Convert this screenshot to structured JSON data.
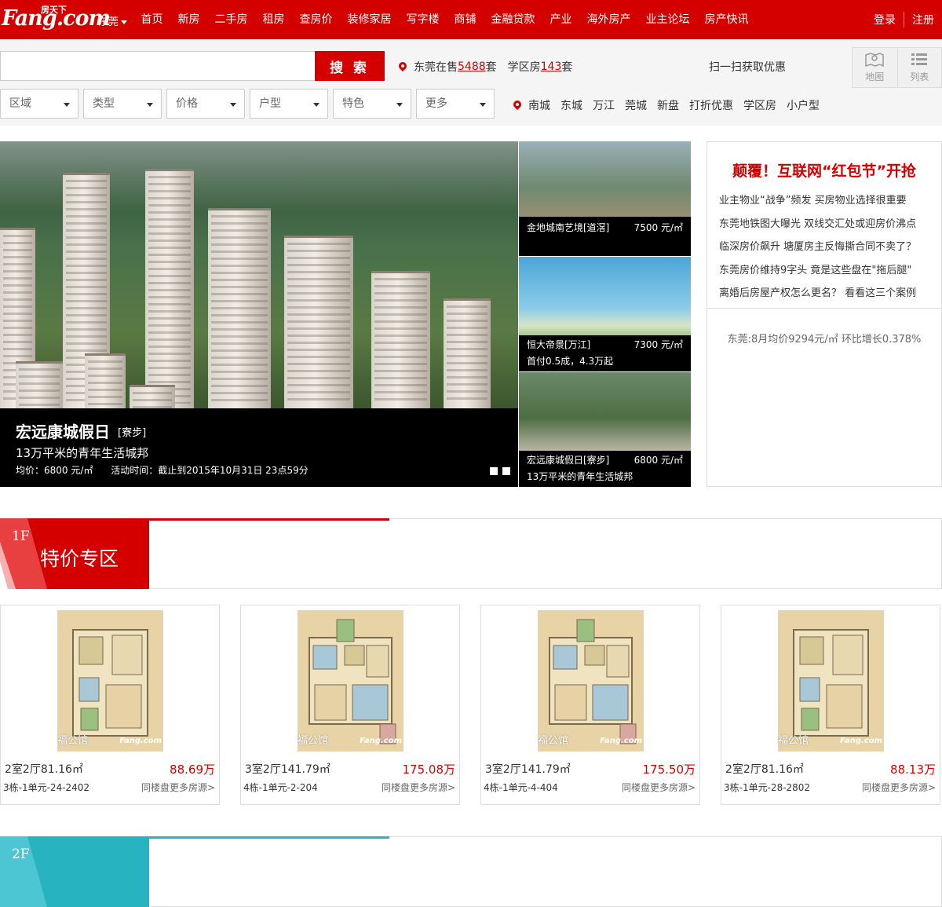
{
  "header": {
    "logo_text": "Fang.com",
    "logo_sub": "房天下",
    "city": "东莞",
    "nav": [
      "首页",
      "新房",
      "二手房",
      "租房",
      "查房价",
      "装修家居",
      "写字楼",
      "商铺",
      "金融贷款",
      "产业",
      "海外房产",
      "业主论坛",
      "房产快讯"
    ],
    "login": "登录",
    "register": "注册"
  },
  "search": {
    "placeholder": "",
    "button": "搜 索",
    "stat_prefix": "东莞在售",
    "stat_count": "5488",
    "stat_unit": "套",
    "school_prefix": "学区房",
    "school_count": "143",
    "school_unit": "套",
    "scan": "扫一扫获取优惠",
    "view_map": "地图",
    "view_list": "列表",
    "filters": [
      "区域",
      "类型",
      "价格",
      "户型",
      "特色",
      "更多"
    ],
    "quick": [
      "南城",
      "东城",
      "万江",
      "莞城",
      "新盘",
      "打折优惠",
      "学区房",
      "小户型"
    ]
  },
  "hero": {
    "title": "宏远康城假日",
    "tag": "[寮步]",
    "subtitle": "13万平米的青年生活城邦",
    "meta": "均价：6800 元/㎡      活动时间：截止到2015年10月31日 23点59分"
  },
  "thumbs": [
    {
      "name": "金地城南艺境[道滘]",
      "price": "7500 元/㎡",
      "note": ""
    },
    {
      "name": "恒大帝景[万江]",
      "price": "7300 元/㎡",
      "note": "首付0.5成，4.3万起"
    },
    {
      "name": "宏远康城假日[寮步]",
      "price": "6800 元/㎡",
      "note": "13万平米的青年生活城邦"
    }
  ],
  "news": {
    "headline": "颠覆！互联网“红包节”开抢",
    "items": [
      "业主物业“战争”频发 买房物业选择很重要",
      "东莞地铁图大曝光 双线交汇处或迎房价沸点",
      "临深房价飙升 塘厦房主反悔撕合同不卖了？",
      "东莞房价维持9字头 竟是这些盘在\"拖后腿\"",
      "离婚后房屋产权怎么更名？ 看看这三个案例"
    ],
    "footer": "东莞:8月均价9294元/㎡ 环比增长0.378%"
  },
  "floor1": {
    "num": "1F",
    "title": "特价专区",
    "color": "#d40000"
  },
  "floor2": {
    "num": "2F",
    "color": "#27b3c0"
  },
  "cards": [
    {
      "room": "2室2厅81.16㎡",
      "price": "88.69万",
      "unit": "3栋-1单元-24-2402",
      "more": "同楼盘更多房源>",
      "label": "福公馆",
      "wm": "Fang.com"
    },
    {
      "room": "3室2厅141.79㎡",
      "price": "175.08万",
      "unit": "4栋-1单元-2-204",
      "more": "同楼盘更多房源>",
      "label": "福公馆",
      "wm": "Fang.com"
    },
    {
      "room": "3室2厅141.79㎡",
      "price": "175.50万",
      "unit": "4栋-1单元-4-404",
      "more": "同楼盘更多房源>",
      "label": "福公馆",
      "wm": "Fang.com"
    },
    {
      "room": "2室2厅81.16㎡",
      "price": "88.13万",
      "unit": "3栋-1单元-28-2802",
      "more": "同楼盘更多房源>",
      "label": "福公馆",
      "wm": "Fang.com"
    }
  ]
}
